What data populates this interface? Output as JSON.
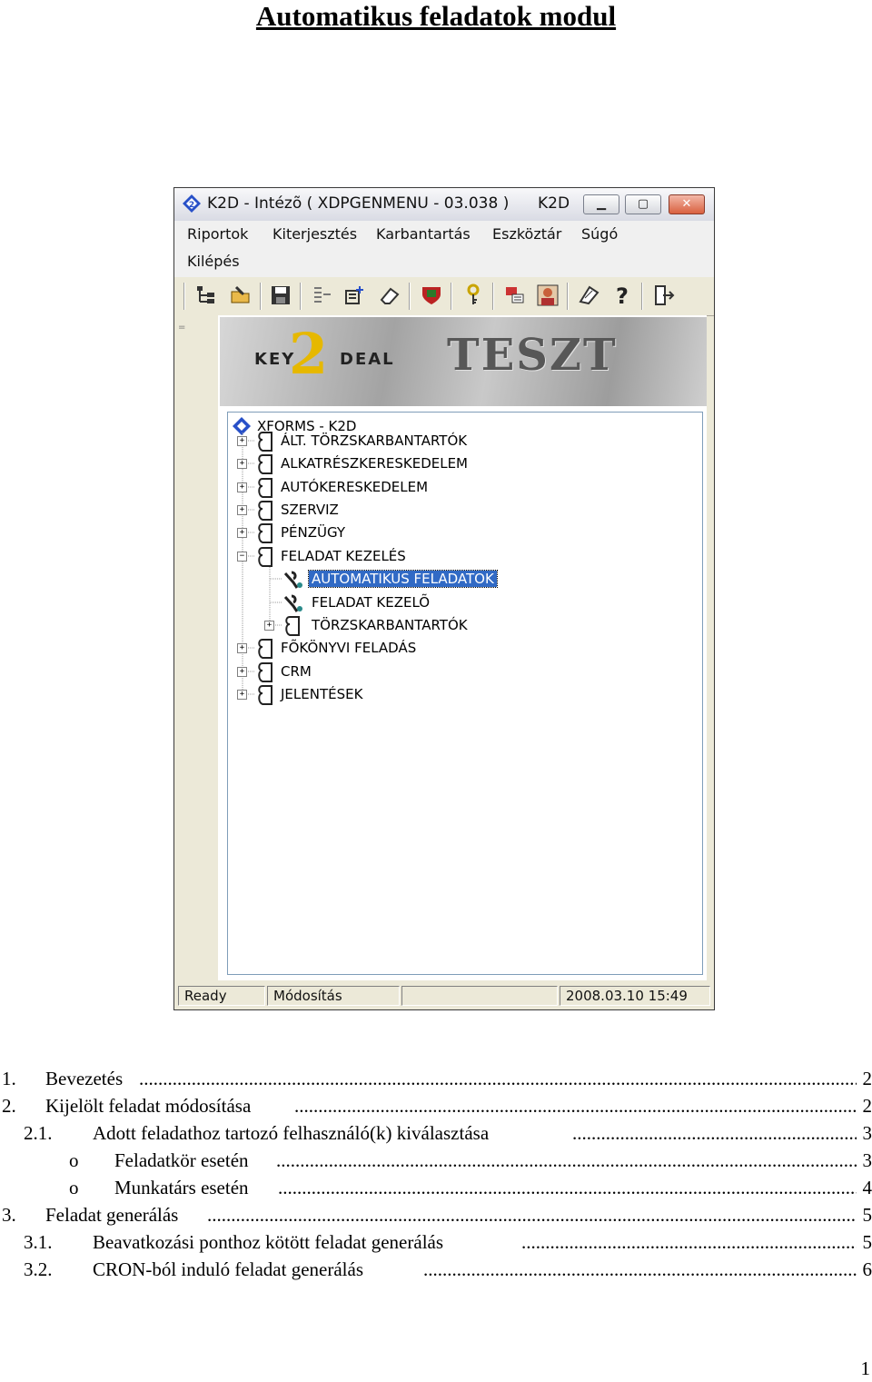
{
  "document": {
    "title": "Automatikus feladatok modul",
    "page_number": "1"
  },
  "window": {
    "title": "K2D - Intézõ ( XDPGENMENU - 03.038 )",
    "title_right": "K2D",
    "menu": [
      "Riportok",
      "Kiterjesztés",
      "Karbantartás",
      "Eszköztár",
      "Súgó",
      "Kilépés"
    ],
    "toolbar_icons": [
      "tree-icon",
      "open-icon",
      "save-icon",
      "list-icon",
      "properties-icon",
      "eraser-icon",
      "shield-icon",
      "key-icon",
      "transfer-icon",
      "user-icon",
      "edit-icon",
      "help-icon",
      "exit-icon"
    ],
    "banner": {
      "logo_key": "KEY",
      "logo_two": "2",
      "logo_deal": "DEAL",
      "label": "TESZT"
    },
    "tree": {
      "root": "XFORMS - K2D",
      "items": [
        {
          "label": "ÁLT. TÖRZSKARBANTARTÓK",
          "state": "collapsed"
        },
        {
          "label": "ALKATRÉSZKERESKEDELEM",
          "state": "collapsed"
        },
        {
          "label": "AUTÓKERESKEDELEM",
          "state": "collapsed"
        },
        {
          "label": "SZERVIZ",
          "state": "collapsed"
        },
        {
          "label": "PÉNZÜGY",
          "state": "collapsed"
        },
        {
          "label": "FELADAT KEZELÉS",
          "state": "expanded"
        },
        {
          "label": "AUTOMATIKUS FELADATOK",
          "state": "leaf",
          "selected": true
        },
        {
          "label": "FELADAT KEZELÕ",
          "state": "leaf"
        },
        {
          "label": "TÖRZSKARBANTARTÓK",
          "state": "collapsed"
        },
        {
          "label": "FÕKÖNYVI FELADÁS",
          "state": "collapsed"
        },
        {
          "label": "CRM",
          "state": "collapsed"
        },
        {
          "label": "JELENTÉSEK",
          "state": "collapsed"
        }
      ]
    },
    "status": {
      "state": "Ready",
      "mode": "Módosítás",
      "datetime": "2008.03.10 15:49"
    },
    "colors": {
      "selection": "#316ac5",
      "banner_text": "#575757"
    }
  },
  "toc": [
    {
      "num": "1.",
      "text": "Bevezetés",
      "page": "2"
    },
    {
      "num": "2.",
      "text": "Kijelölt feladat módosítása",
      "page": "2"
    },
    {
      "num": "2.1.",
      "text": "Adott feladathoz tartozó felhasználó(k) kiválasztása",
      "page": "3"
    },
    {
      "num": "o",
      "text": "Feladatkör esetén",
      "page": "3"
    },
    {
      "num": "o",
      "text": "Munkatárs esetén",
      "page": "4"
    },
    {
      "num": "3.",
      "text": "Feladat generálás",
      "page": "5"
    },
    {
      "num": "3.1.",
      "text": "Beavatkozási ponthoz kötött feladat generálás",
      "page": "5"
    },
    {
      "num": "3.2.",
      "text": "CRON-ból induló feladat generálás",
      "page": "6"
    }
  ]
}
